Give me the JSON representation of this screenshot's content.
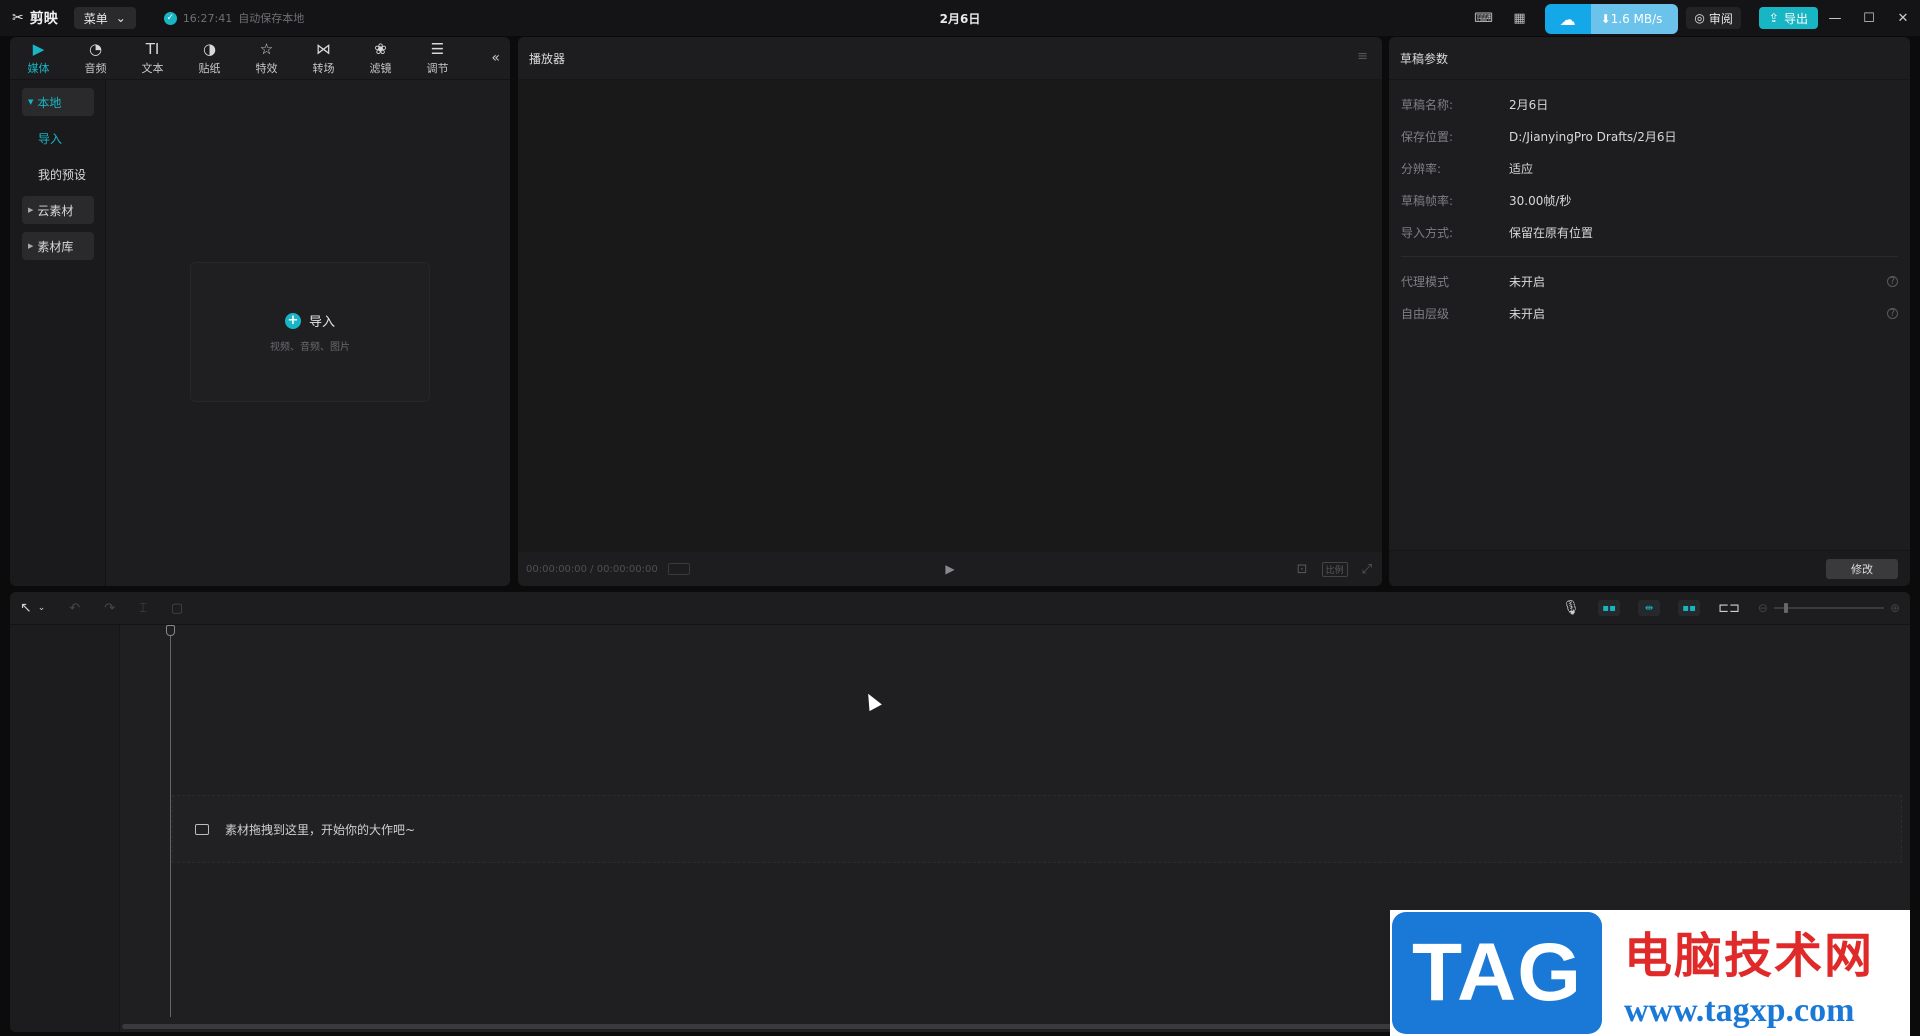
{
  "app": {
    "name": "剪映",
    "menu_label": "菜单",
    "autosave_time": "16:27:41",
    "autosave_text": "自动保存本地",
    "doc_title": "2月6日",
    "speed": "1.6 MB/s",
    "review_label": "审阅",
    "export_label": "导出"
  },
  "media": {
    "tabs": [
      {
        "label": "媒体",
        "icon": "media-icon"
      },
      {
        "label": "音频",
        "icon": "audio-icon"
      },
      {
        "label": "文本",
        "icon": "text-icon"
      },
      {
        "label": "贴纸",
        "icon": "sticker-icon"
      },
      {
        "label": "特效",
        "icon": "effect-icon"
      },
      {
        "label": "转场",
        "icon": "transition-icon"
      },
      {
        "label": "滤镜",
        "icon": "filter-icon"
      },
      {
        "label": "调节",
        "icon": "adjust-icon"
      }
    ],
    "sidebar": {
      "local": "本地",
      "import": "导入",
      "presets": "我的预设",
      "cloud": "云素材",
      "library": "素材库"
    },
    "import_card": {
      "label": "导入",
      "hint": "视频、音频、图片"
    }
  },
  "player": {
    "title": "播放器",
    "timecode": "00:00:00:00 / 00:00:00:00",
    "ratio_label": "比例"
  },
  "props": {
    "title": "草稿参数",
    "rows": [
      {
        "label": "草稿名称:",
        "value": "2月6日"
      },
      {
        "label": "保存位置:",
        "value": "D:/JianyingPro Drafts/2月6日"
      },
      {
        "label": "分辨率:",
        "value": "适应"
      },
      {
        "label": "草稿帧率:",
        "value": "30.00帧/秒"
      },
      {
        "label": "导入方式:",
        "value": "保留在原有位置"
      }
    ],
    "rows2": [
      {
        "label": "代理模式",
        "value": "未开启"
      },
      {
        "label": "自由层级",
        "value": "未开启"
      }
    ],
    "modify_label": "修改"
  },
  "timeline": {
    "drop_hint": "素材拖拽到这里，开始你的大作吧~"
  },
  "watermark": {
    "tag": "TAG",
    "site_cn": "电脑技术网",
    "url": "www.tagxp.com"
  },
  "colors": {
    "accent": "#18b6c4",
    "bg": "#1d1d1f"
  }
}
